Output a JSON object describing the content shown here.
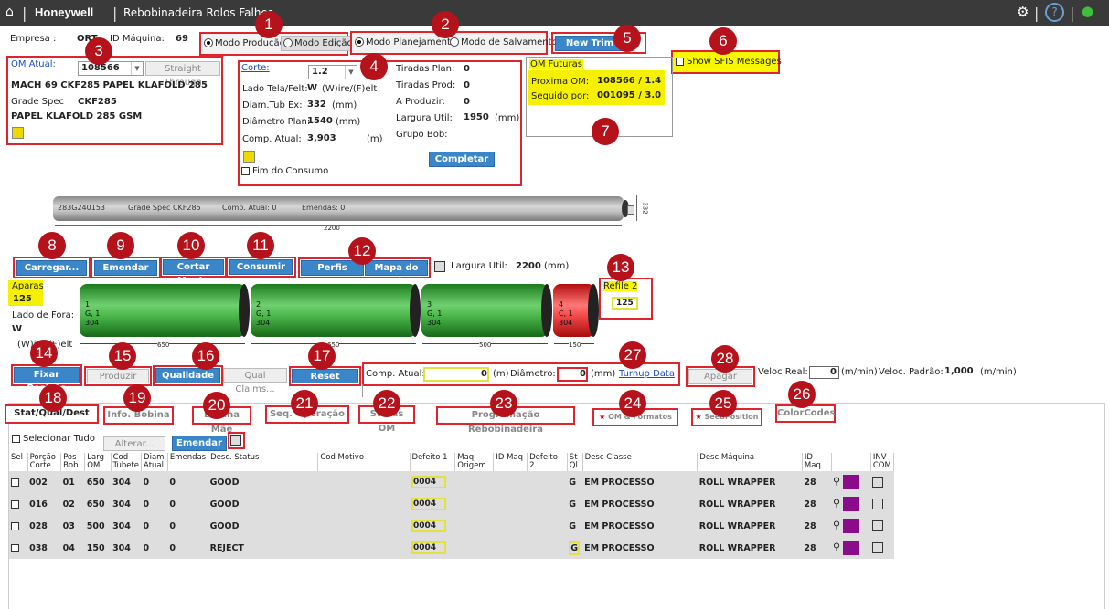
{
  "header": {
    "home_icon": "home-icon",
    "brand": "Honeywell",
    "app_title": "Rebobinadeira Rolos Falhos",
    "help_label": "?"
  },
  "info": {
    "empresa_label": "Empresa :",
    "empresa_value": "ORT",
    "id_maquina_label": "ID Máquina:",
    "id_maquina_value": "69"
  },
  "modes": {
    "producao": "Modo Produção",
    "edicao": "Modo Edição",
    "planejamento": "Modo Planejamento",
    "salvamento": "Modo de Salvamento",
    "new_trim": "New Trim",
    "show_sfis": "Show SFIS Messages"
  },
  "om": {
    "label": "OM Atual:",
    "value": "108566",
    "straight": "Straight Through",
    "line1": "MACH 69 CKF285 PAPEL KLAFOLD 285",
    "grade_label": "Grade Spec",
    "grade_value": "CKF285",
    "line3": "PAPEL KLAFOLD 285 GSM"
  },
  "corte": {
    "label": "Corte:",
    "value": "1.2",
    "lado_label": "Lado Tela/Felt:",
    "lado_value": "W",
    "lado_hint": "(W)ire/(F)elt",
    "diam_tub_label": "Diam.Tub Ex:",
    "diam_tub_value": "332",
    "diam_tub_unit": "(mm)",
    "diam_plan_label": "Diâmetro Plan:",
    "diam_plan_value": "1540",
    "diam_plan_unit": "(mm)",
    "comp_label": "Comp. Atual:",
    "comp_value": "3,903",
    "comp_unit": "(m)",
    "fim_label": "Fim do Consumo",
    "tiradas_plan_label": "Tiradas Plan:",
    "tiradas_plan_value": "0",
    "tiradas_prod_label": "Tiradas Prod:",
    "tiradas_prod_value": "0",
    "a_produzir_label": "A Produzir:",
    "a_produzir_value": "0",
    "largura_label": "Largura Util:",
    "largura_value": "1950",
    "largura_unit": "(mm)",
    "grupo_label": "Grupo Bob:",
    "completar": "Completar"
  },
  "futuras": {
    "title": "OM Futuras",
    "proxima_label": "Proxima OM:",
    "proxima_value": "108566 / 1.4",
    "seguido_label": "Seguido por:",
    "seguido_value": "001095 / 3.0"
  },
  "parent_roll": {
    "id": "283G240153",
    "grade": "Grade Spec CKF285",
    "comp": "Comp. Atual: 0",
    "emendas": "Emendas: 0",
    "width": "2200",
    "diam": "332"
  },
  "actions": {
    "carregar": "Carregar...",
    "emendar": "Emendar",
    "cortar": "Cortar Manta",
    "consumir": "Consumir",
    "perfis": "Perfis",
    "mapa": "Mapa do Rolo",
    "largura_label": "Largura Util:",
    "largura_value": "2200",
    "largura_unit": "(mm)"
  },
  "left_info": {
    "aparas_label": "Aparas",
    "aparas_value": "125",
    "lado_label": "Lado de Fora:",
    "lado_value": "W",
    "lado_hint": "(W)ire/(F)elt"
  },
  "rolls": [
    {
      "text": "1\nG, 1\n304",
      "width": "650"
    },
    {
      "text": "2\nG, 1\n304",
      "width": "650"
    },
    {
      "text": "3\nG, 1\n304",
      "width": "500"
    },
    {
      "text": "4\nC, 1\n304",
      "width": "150"
    }
  ],
  "refile": {
    "label": "Refile 2",
    "value": "125"
  },
  "controls": {
    "fixar": "Fixar Posição",
    "produzir": "Produzir",
    "qualidade": "Qualidade",
    "qual_claims": "Qual Claims...",
    "reset": "Reset",
    "comp_label": "Comp. Atual:",
    "comp_value": "0",
    "comp_unit": "(m)",
    "diam_label": "Diâmetro:",
    "diam_value": "0",
    "diam_unit": "(mm)",
    "turnup": "Turnup Data",
    "apagar": "Apagar",
    "veloc_label": "Veloc Real:",
    "veloc_value": "0",
    "veloc_unit": "(m/min)",
    "veloc_padrao_label": "Veloc. Padrão:",
    "veloc_padrao_value": "1,000",
    "veloc_padrao_unit": "(m/min)"
  },
  "tabs": [
    "Stat/Qual/Dest",
    "Info. Bobina",
    "Bobina Mãe",
    "Seq. Operação",
    "Status OM",
    "Programação Rebobinadeira",
    "OM & Formatos",
    "SeedPosition",
    "ColorCodes"
  ],
  "table_toolbar": {
    "select_all": "Selecionar Tudo",
    "alterar": "Alterar...",
    "emendar": "Emendar"
  },
  "table": {
    "headers": [
      "Sel",
      "Porção Corte",
      "Pos Bob",
      "Larg OM",
      "Cod Tubete",
      "Diam Atual",
      "Emendas",
      "Desc. Status",
      "Cod Motivo",
      "Defeito 1",
      "Maq Origem",
      "ID Maq",
      "Defeito 2",
      "St Ql",
      "Desc Classe",
      "Desc Máquina",
      "ID Maq",
      "",
      "INV COM"
    ],
    "rows": [
      {
        "porcao": "002",
        "pos": "01",
        "larg": "650",
        "tubete": "304",
        "diam": "0",
        "emendas": "0",
        "status": "GOOD",
        "defeito1": "0004",
        "stql": "G",
        "classe": "EM PROCESSO",
        "maquina": "ROLL WRAPPER",
        "idmaq": "28"
      },
      {
        "porcao": "016",
        "pos": "02",
        "larg": "650",
        "tubete": "304",
        "diam": "0",
        "emendas": "0",
        "status": "GOOD",
        "defeito1": "0004",
        "stql": "G",
        "classe": "EM PROCESSO",
        "maquina": "ROLL WRAPPER",
        "idmaq": "28"
      },
      {
        "porcao": "028",
        "pos": "03",
        "larg": "500",
        "tubete": "304",
        "diam": "0",
        "emendas": "0",
        "status": "GOOD",
        "defeito1": "0004",
        "stql": "G",
        "classe": "EM PROCESSO",
        "maquina": "ROLL WRAPPER",
        "idmaq": "28"
      },
      {
        "porcao": "038",
        "pos": "04",
        "larg": "150",
        "tubete": "304",
        "diam": "0",
        "emendas": "0",
        "status": "REJECT",
        "defeito1": "0004",
        "stql": "G",
        "classe": "EM PROCESSO",
        "maquina": "ROLL WRAPPER",
        "idmaq": "28"
      }
    ]
  },
  "badges": [
    "1",
    "2",
    "3",
    "4",
    "5",
    "6",
    "7",
    "8",
    "9",
    "10",
    "11",
    "12",
    "13",
    "14",
    "15",
    "16",
    "17",
    "18",
    "19",
    "20",
    "21",
    "22",
    "23",
    "24",
    "25",
    "26",
    "27",
    "28"
  ]
}
